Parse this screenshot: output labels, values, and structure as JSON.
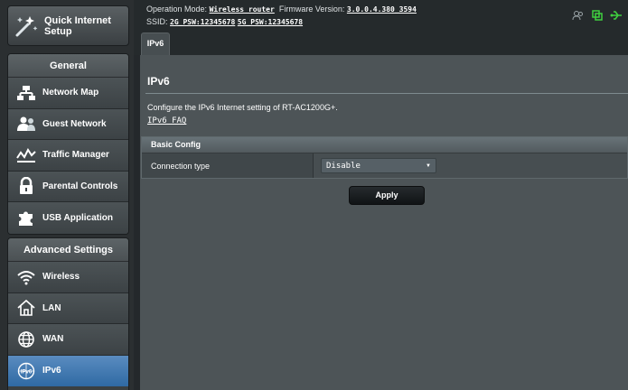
{
  "sidebar": {
    "quick_setup": {
      "label_line1": "Quick Internet",
      "label_line2": "Setup"
    },
    "general": {
      "title": "General",
      "items": [
        {
          "label": "Network Map",
          "icon": "network-map-icon"
        },
        {
          "label": "Guest Network",
          "icon": "guest-network-icon"
        },
        {
          "label": "Traffic Manager",
          "icon": "traffic-manager-icon"
        },
        {
          "label": "Parental Controls",
          "icon": "lock-icon"
        },
        {
          "label": "USB Application",
          "icon": "puzzle-icon"
        }
      ]
    },
    "advanced": {
      "title": "Advanced Settings",
      "items": [
        {
          "label": "Wireless",
          "icon": "wifi-icon"
        },
        {
          "label": "LAN",
          "icon": "home-icon"
        },
        {
          "label": "WAN",
          "icon": "globe-icon"
        },
        {
          "label": "IPv6",
          "icon": "ipv6-icon",
          "active": true
        }
      ]
    }
  },
  "header": {
    "op_mode_label": "Operation Mode:",
    "op_mode_value": "Wireless router",
    "firmware_label": "Firmware Version:",
    "firmware_value": "3.0.0.4.380_3594",
    "ssid_label": "SSID:",
    "ssid_2g": "2G_PSW:12345678",
    "ssid_5g": "5G_PSW:12345678"
  },
  "tab": {
    "label": "IPv6"
  },
  "main": {
    "title": "IPv6",
    "description": "Configure the IPv6 Internet setting of RT-AC1200G+.",
    "faq_link": "IPv6 FAQ",
    "basic_config": {
      "title": "Basic Config",
      "connection_type_label": "Connection type",
      "connection_type_value": "Disable"
    },
    "apply_label": "Apply"
  },
  "colors": {
    "accent_active": "#3d78b5",
    "status_icon_green": "#3fcf3f"
  }
}
